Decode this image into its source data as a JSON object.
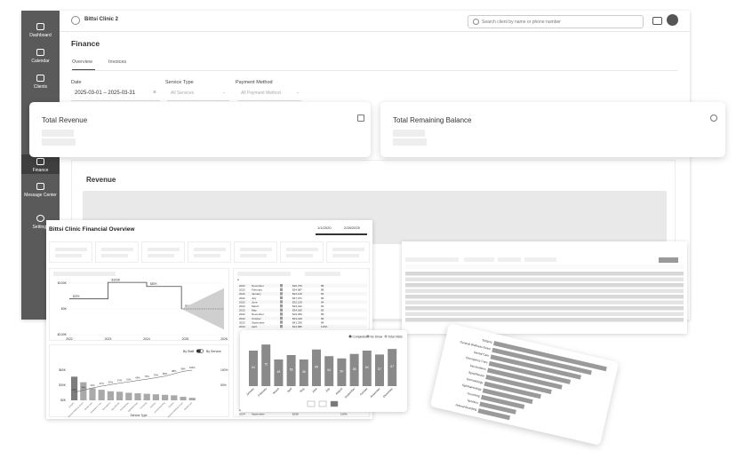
{
  "app": {
    "clinic_name": "Bittsi Clinic 2",
    "search_placeholder": "Search client by name or phone number"
  },
  "sidebar": {
    "items": [
      {
        "label": "Dashboard"
      },
      {
        "label": "Calendar"
      },
      {
        "label": "Clients"
      },
      {
        "label": "Finance"
      },
      {
        "label": "Message Center"
      },
      {
        "label": "Settings"
      }
    ]
  },
  "page": {
    "title": "Finance",
    "tabs": [
      {
        "label": "Overview"
      },
      {
        "label": "Invoices"
      }
    ]
  },
  "filters": {
    "date_label": "Date",
    "date_value": "2025-03-01 – 2025-03-31",
    "service_label": "Service Type",
    "service_value": "All Services",
    "payment_label": "Payment Method",
    "payment_value": "All Payment Method"
  },
  "cards": {
    "total_revenue": "Total Revenue",
    "total_remaining": "Total Remaining Balance"
  },
  "revenue": {
    "title": "Revenue"
  },
  "overview": {
    "title": "Bittsi Clinic Financial Overview",
    "date_start": "1/1/2020",
    "date_end": "2/28/2025",
    "toggle_by_staff": "By Staff",
    "toggle_by_service": "By Service"
  },
  "colors": {
    "sidebar": "#5a5a5a",
    "bar_dark": "#7d7d7d",
    "bar_light": "#a9a9a9"
  },
  "chart_data": [
    {
      "type": "line",
      "x_ticks": [
        "2022",
        "2023",
        "2024",
        "2025",
        "2026"
      ],
      "y_ticks": [
        "$100K",
        "$0K",
        "-$100K"
      ],
      "points": [
        {
          "x": 2022,
          "y": 3.9
        },
        {
          "x": 2023,
          "y": 10.3
        },
        {
          "x": 2024,
          "y": 8.7
        },
        {
          "x": 2024.9,
          "y": 0.0
        }
      ],
      "point_labels": [
        "$37K",
        "$103K",
        "$87K",
        "$0K"
      ]
    },
    {
      "type": "bar",
      "y_ticks": [
        "$60K",
        "$30K",
        "$0K"
      ],
      "y2_ticks": [
        "100%",
        "50%"
      ],
      "xlabel": "Service Type",
      "values": [
        47,
        36,
        24,
        21,
        18,
        17,
        15,
        14,
        13,
        12,
        11,
        10,
        7,
        5,
        4,
        3
      ],
      "cumulative_pct": [
        "26%",
        "34%",
        "41%",
        "47%",
        "52%",
        "57%",
        "61%",
        "66%",
        "70%",
        "75%",
        "80%",
        "88%",
        "96%",
        "100%",
        "100%",
        "100%"
      ]
    },
    {
      "type": "bar",
      "legend": [
        "Completed",
        "No Show",
        "Total Visits"
      ],
      "categories": [
        "January",
        "February",
        "March",
        "April",
        "May",
        "June",
        "July",
        "August",
        "September",
        "October",
        "November",
        "December"
      ],
      "values": [
        64,
        75,
        48,
        56,
        48,
        66,
        54,
        50,
        58,
        64,
        57,
        67
      ]
    }
  ],
  "table": {
    "rows": [
      {
        "year": "2022",
        "month": "November",
        "amount": "$10,376",
        "n": "88"
      },
      {
        "year": "2022",
        "month": "February",
        "amount": "$34,987",
        "n": "88"
      },
      {
        "year": "2022",
        "month": "January",
        "amount": "$24,149",
        "n": "84"
      },
      {
        "year": "2022",
        "month": "July",
        "amount": "$37,071",
        "n": "86"
      },
      {
        "year": "2022",
        "month": "June",
        "amount": "$32,219",
        "n": "94"
      },
      {
        "year": "2022",
        "month": "March",
        "amount": "$33,442",
        "n": "60"
      },
      {
        "year": "2022",
        "month": "May",
        "amount": "$34,180",
        "n": "83"
      },
      {
        "year": "2022",
        "month": "November",
        "amount": "$19,396",
        "n": "86"
      },
      {
        "year": "2022",
        "month": "October",
        "amount": "$23,448",
        "n": "86"
      },
      {
        "year": "2022",
        "month": "September",
        "amount": "$41,336",
        "n": "84"
      },
      {
        "year": "2023",
        "month": "April",
        "amount": "$14,980",
        "n": "116%"
      }
    ],
    "bottom_rows": [
      {
        "year": "2024",
        "month": "October",
        "amount": "$77",
        "n": "100%"
      },
      {
        "year": "2024",
        "month": "September",
        "amount": "$158",
        "n": "100%"
      }
    ]
  },
  "hbar": {
    "labels": [
      "Surgery",
      "General Wellness Exam",
      "Dental Care",
      "Emergency Care",
      "Vaccinations",
      "Spay/Neuter",
      "Dermatology",
      "Ophthalmology",
      "Grooming",
      "Nutrition",
      "Animal Boarding"
    ],
    "values": [
      100,
      88,
      80,
      72,
      66,
      58,
      50,
      44,
      38,
      32,
      28
    ]
  }
}
